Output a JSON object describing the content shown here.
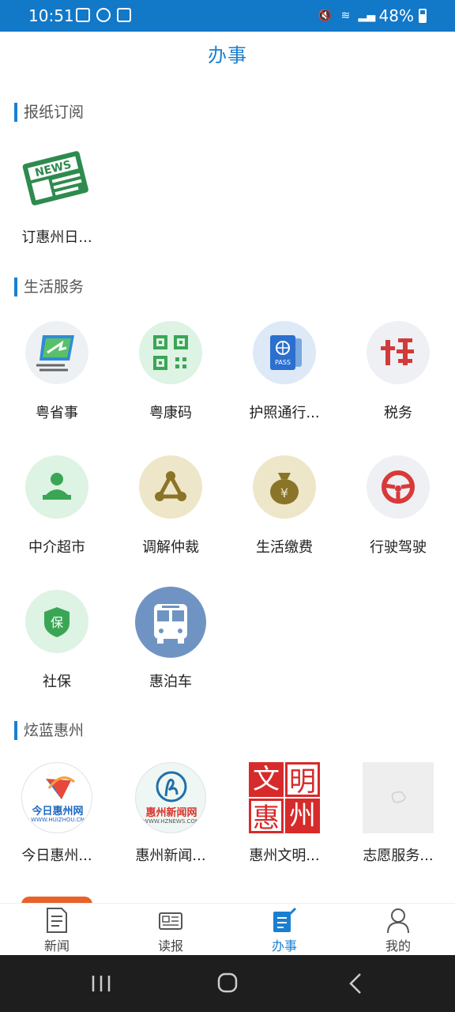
{
  "status": {
    "time": "10:51",
    "battery": "48%"
  },
  "header": {
    "title": "办事"
  },
  "sections": {
    "newspaper": {
      "title": "报纸订阅",
      "items": [
        {
          "label": "订惠州日...",
          "icon": "news-icon"
        }
      ]
    },
    "life": {
      "title": "生活服务",
      "items": [
        {
          "label": "粤省事",
          "icon": "yueshengshi-icon"
        },
        {
          "label": "粤康码",
          "icon": "qr-code-icon"
        },
        {
          "label": "护照通行...",
          "icon": "passport-icon"
        },
        {
          "label": "税务",
          "icon": "tax-icon"
        },
        {
          "label": "中介超市",
          "icon": "agent-icon"
        },
        {
          "label": "调解仲裁",
          "icon": "network-triangle-icon"
        },
        {
          "label": "生活缴费",
          "icon": "money-bag-icon"
        },
        {
          "label": "行驶驾驶",
          "icon": "steering-wheel-icon"
        },
        {
          "label": "社保",
          "icon": "shield-icon"
        },
        {
          "label": "惠泊车",
          "icon": "bus-icon"
        }
      ]
    },
    "brand": {
      "title": "炫蓝惠州",
      "items": [
        {
          "label": "今日惠州...",
          "icon": "jinri-huizhou-logo",
          "logo_text": "今日惠州网",
          "logo_sub": "WWW.HUIZHOU.CN"
        },
        {
          "label": "惠州新闻...",
          "icon": "hznews-logo",
          "logo_text": "惠州新闻网",
          "logo_sub": "WWW.HZNEWS.COM"
        },
        {
          "label": "惠州文明...",
          "icon": "wenming-seal",
          "logo_chars": [
            "文",
            "明",
            "惠",
            "州"
          ]
        },
        {
          "label": "志愿服务...",
          "icon": "placeholder-image-icon"
        }
      ]
    }
  },
  "bottom_nav": {
    "items": [
      {
        "label": "新闻",
        "icon": "news-doc-icon"
      },
      {
        "label": "读报",
        "icon": "newspaper-icon"
      },
      {
        "label": "办事",
        "icon": "edit-doc-icon",
        "active": true
      },
      {
        "label": "我的",
        "icon": "person-icon"
      }
    ]
  },
  "colors": {
    "accent": "#1a7fd0",
    "statusbar": "#1278c8"
  }
}
